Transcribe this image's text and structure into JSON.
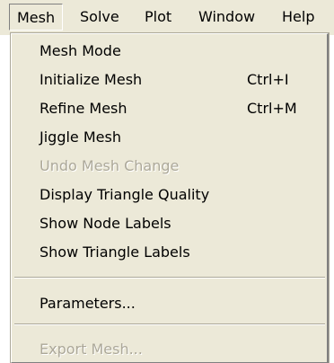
{
  "menubar": {
    "items": [
      "Mesh",
      "Solve",
      "Plot",
      "Window",
      "Help"
    ]
  },
  "mesh_menu": {
    "items": [
      {
        "label": "Mesh Mode",
        "shortcut": "",
        "enabled": true
      },
      {
        "label": "Initialize Mesh",
        "shortcut": "Ctrl+I",
        "enabled": true
      },
      {
        "label": "Refine Mesh",
        "shortcut": "Ctrl+M",
        "enabled": true
      },
      {
        "label": "Jiggle Mesh",
        "shortcut": "",
        "enabled": true
      },
      {
        "label": "Undo Mesh Change",
        "shortcut": "",
        "enabled": false
      },
      {
        "label": "Display Triangle Quality",
        "shortcut": "",
        "enabled": true
      },
      {
        "label": "Show Node Labels",
        "shortcut": "",
        "enabled": true
      },
      {
        "label": "Show Triangle Labels",
        "shortcut": "",
        "enabled": true
      },
      {
        "label": "Parameters...",
        "shortcut": "",
        "enabled": true
      },
      {
        "label": "Export Mesh...",
        "shortcut": "",
        "enabled": false
      }
    ]
  }
}
